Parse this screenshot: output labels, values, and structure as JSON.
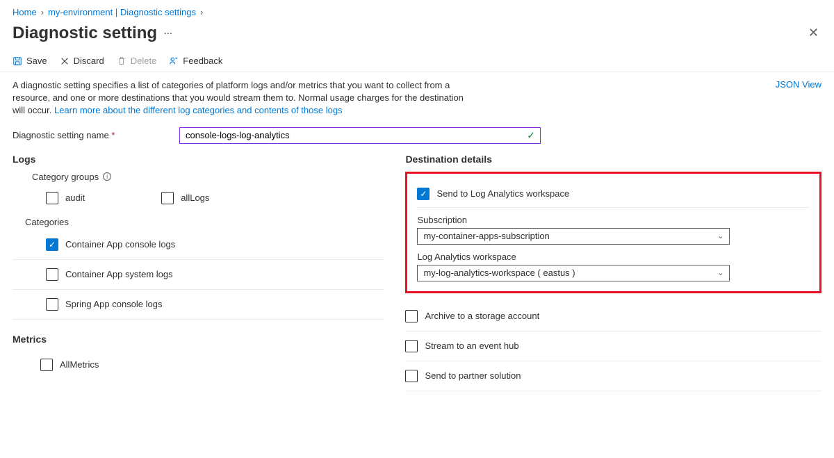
{
  "breadcrumb": {
    "home": "Home",
    "env": "my-environment | Diagnostic settings"
  },
  "page": {
    "title": "Diagnostic setting"
  },
  "toolbar": {
    "save": "Save",
    "discard": "Discard",
    "delete": "Delete",
    "feedback": "Feedback"
  },
  "description": {
    "text": "A diagnostic setting specifies a list of categories of platform logs and/or metrics that you want to collect from a resource, and one or more destinations that you would stream them to. Normal usage charges for the destination will occur. ",
    "link": "Learn more about the different log categories and contents of those logs"
  },
  "json_view": "JSON View",
  "name_field": {
    "label": "Diagnostic setting name",
    "value": "console-logs-log-analytics"
  },
  "logs": {
    "title": "Logs",
    "category_groups_label": "Category groups",
    "groups": {
      "audit": {
        "label": "audit",
        "checked": false
      },
      "allLogs": {
        "label": "allLogs",
        "checked": false
      }
    },
    "categories_label": "Categories",
    "categories": [
      {
        "label": "Container App console logs",
        "checked": true
      },
      {
        "label": "Container App system logs",
        "checked": false
      },
      {
        "label": "Spring App console logs",
        "checked": false
      }
    ]
  },
  "metrics": {
    "title": "Metrics",
    "items": [
      {
        "label": "AllMetrics",
        "checked": false
      }
    ]
  },
  "destination": {
    "title": "Destination details",
    "log_analytics": {
      "label": "Send to Log Analytics workspace",
      "checked": true,
      "subscription_label": "Subscription",
      "subscription_value": "my-container-apps-subscription",
      "workspace_label": "Log Analytics workspace",
      "workspace_value": "my-log-analytics-workspace ( eastus )"
    },
    "others": [
      {
        "label": "Archive to a storage account",
        "checked": false
      },
      {
        "label": "Stream to an event hub",
        "checked": false
      },
      {
        "label": "Send to partner solution",
        "checked": false
      }
    ]
  }
}
